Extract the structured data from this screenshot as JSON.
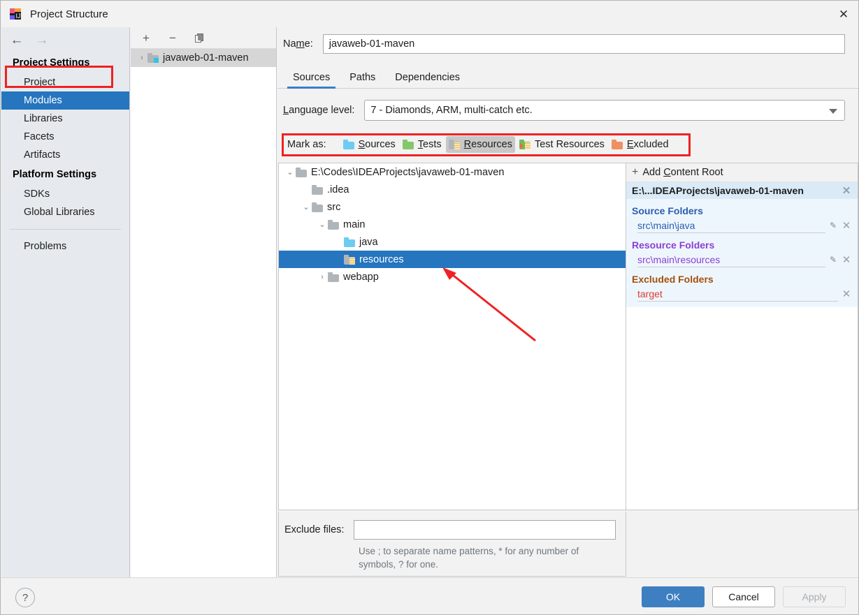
{
  "window": {
    "title": "Project Structure",
    "app_icon": "intellij-idea-icon",
    "close_label": "✕"
  },
  "sidebar": {
    "back_icon": "←",
    "forward_icon": "→",
    "groups": [
      {
        "title": "Project Settings",
        "items": [
          {
            "label": "Project",
            "selected": false
          },
          {
            "label": "Modules",
            "selected": true
          },
          {
            "label": "Libraries",
            "selected": false
          },
          {
            "label": "Facets",
            "selected": false
          },
          {
            "label": "Artifacts",
            "selected": false
          }
        ]
      },
      {
        "title": "Platform Settings",
        "items": [
          {
            "label": "SDKs",
            "selected": false
          },
          {
            "label": "Global Libraries",
            "selected": false
          }
        ]
      }
    ],
    "problems_label": "Problems",
    "highlight_color": "#ee2222",
    "selection_color": "#2675bf"
  },
  "modules_panel": {
    "toolbar": {
      "add_label": "+",
      "remove_label": "−",
      "copy_label": "❐"
    },
    "items": [
      {
        "label": "javaweb-01-maven",
        "twisty": "›",
        "icon": "module-folder-icon",
        "selected": true
      }
    ]
  },
  "main": {
    "name_label": "Name:",
    "name_label_pre": "Na",
    "name_label_accel": "m",
    "name_label_post": "e:",
    "name_value": "javaweb-01-maven",
    "tabs": [
      {
        "label": "Sources",
        "active": true
      },
      {
        "label": "Paths",
        "active": false
      },
      {
        "label": "Dependencies",
        "active": false
      }
    ],
    "language_level_label_accel": "L",
    "language_level_label_post": "anguage level:",
    "language_level_value": "7 - Diamonds, ARM, multi-catch etc.",
    "mark_as": {
      "label": "Mark as:",
      "buttons": [
        {
          "pre": "",
          "accel": "S",
          "post": "ources",
          "icon": "folder-sources-icon",
          "pressed": false
        },
        {
          "pre": "",
          "accel": "T",
          "post": "ests",
          "icon": "folder-tests-icon",
          "pressed": false
        },
        {
          "pre": "",
          "accel": "R",
          "post": "esources",
          "icon": "folder-resources-icon",
          "pressed": true
        },
        {
          "pre": "Test Resources",
          "accel": "",
          "post": "",
          "icon": "folder-test-resources-icon",
          "pressed": false
        },
        {
          "pre": "",
          "accel": "E",
          "post": "xcluded",
          "icon": "folder-excluded-icon",
          "pressed": false
        }
      ]
    },
    "tree": [
      {
        "label": "E:\\Codes\\IDEAProjects\\javaweb-01-maven",
        "depth": 0,
        "twisty": "⌄",
        "icon": "gray",
        "selected": false
      },
      {
        "label": ".idea",
        "depth": 1,
        "twisty": "",
        "icon": "gray",
        "selected": false
      },
      {
        "label": "src",
        "depth": 1,
        "twisty": "⌄",
        "icon": "gray",
        "selected": false
      },
      {
        "label": "main",
        "depth": 2,
        "twisty": "⌄",
        "icon": "gray",
        "selected": false
      },
      {
        "label": "java",
        "depth": 3,
        "twisty": "",
        "icon": "blue",
        "selected": false
      },
      {
        "label": "resources",
        "depth": 3,
        "twisty": "",
        "icon": "res",
        "selected": true
      },
      {
        "label": "webapp",
        "depth": 2,
        "twisty": "›",
        "icon": "gray",
        "selected": false
      }
    ],
    "exclude": {
      "label": "Exclude files:",
      "value": "",
      "hint": "Use ; to separate name patterns, * for any number of symbols, ? for one."
    }
  },
  "content_roots": {
    "add_label_pre": "Add ",
    "add_label_accel": "C",
    "add_label_post": "ontent Root",
    "add_icon": "plus-icon",
    "root": {
      "path": "E:\\...IDEAProjects\\javaweb-01-maven",
      "remove_icon": "✕"
    },
    "groups": [
      {
        "title": "Source Folders",
        "kind": "src",
        "color": "#2a5eb0",
        "rows": [
          {
            "path": "src\\main\\java",
            "has_edit": true
          }
        ]
      },
      {
        "title": "Resource Folders",
        "kind": "res",
        "color": "#8c3fd4",
        "rows": [
          {
            "path": "src\\main\\resources",
            "has_edit": true
          }
        ]
      },
      {
        "title": "Excluded Folders",
        "kind": "exc",
        "color": "#a3500a",
        "rows": [
          {
            "path": "target",
            "has_edit": false
          }
        ]
      }
    ],
    "edit_icon": "✎"
  },
  "footer": {
    "help_label": "?",
    "ok_label": "OK",
    "cancel_label": "Cancel",
    "apply_label": "Apply"
  },
  "annotations": {
    "arrow_color": "#ee2222",
    "highlight_color": "#ee2222"
  }
}
